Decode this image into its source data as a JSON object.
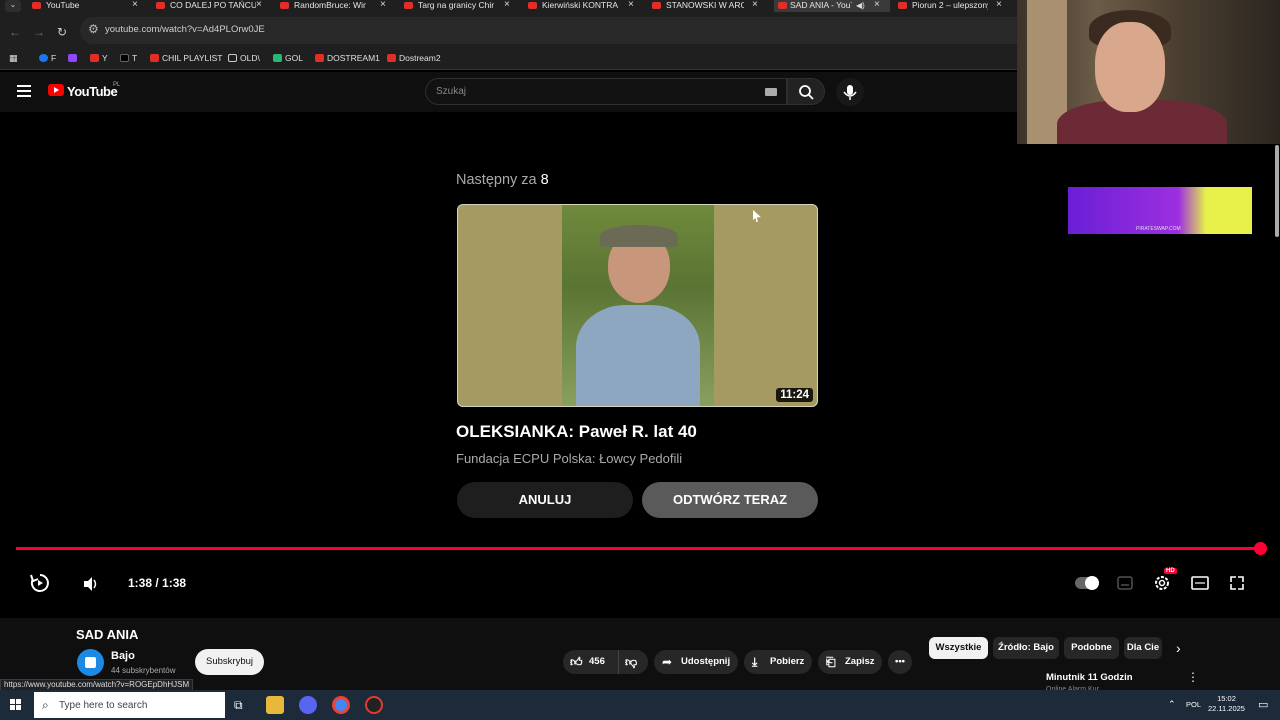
{
  "browser": {
    "tabs": [
      {
        "label": "YouTube",
        "active": false
      },
      {
        "label": "CO DALEJ PO TAŃCU",
        "active": false
      },
      {
        "label": "RandomBruce: Wina",
        "active": false
      },
      {
        "label": "Targ na granicy Chin",
        "active": false
      },
      {
        "label": "Kierwiński KONTRA",
        "active": false
      },
      {
        "label": "STANOWSKI W ARG",
        "active": false
      },
      {
        "label": "SAD ANIA - YouT",
        "active": true
      },
      {
        "label": "Piorun 2 – ulepszony",
        "active": false
      }
    ],
    "url": "youtube.com/watch?v=Ad4PLOrw0JE",
    "bookmarks": [
      "F",
      "Y",
      "T",
      "CHIL PLAYLIST",
      "OLD\\",
      "GOL",
      "DOSTREAM1",
      "Dostream2"
    ],
    "status_url": "https://www.youtube.com/watch?v=ROGEpDhHJSM"
  },
  "youtube": {
    "logo_text": "YouTube",
    "region": "PL",
    "search_placeholder": "Szukaj"
  },
  "endscreen": {
    "next_label": "Następny za",
    "next_count": "8",
    "duration": "11:24",
    "title": "OLEKSIANKA: Paweł R. lat 40",
    "channel": "Fundacja ECPU Polska: Łowcy Pedofili",
    "cancel_label": "ANULUJ",
    "play_now_label": "ODTWÓRZ TERAZ"
  },
  "ad": {
    "text": "PIRATESWAP.COM"
  },
  "player": {
    "time": "1:38 / 1:38",
    "progress": 1.0,
    "quality_badge": "HD"
  },
  "video": {
    "title": "SAD ANIA",
    "channel": "Bajo",
    "subscribers": "44 subskrybentów",
    "subscribe_label": "Subskrybuj",
    "likes": "456",
    "share_label": "Udostępnij",
    "download_label": "Pobierz",
    "save_label": "Zapisz"
  },
  "chips": [
    "Wszystkie",
    "Źródło: Bajo",
    "Podobne",
    "Dla Cie"
  ],
  "recommended": {
    "title": "Minutnik 11 Godzin",
    "subtitle": "Online Alarm Kur"
  },
  "taskbar": {
    "search_placeholder": "Type here to search",
    "lang": "POL",
    "time": "15:02",
    "date": "22.11.2025"
  },
  "colors": {
    "accent": "#ff0033",
    "background": "#0f0f0f"
  }
}
